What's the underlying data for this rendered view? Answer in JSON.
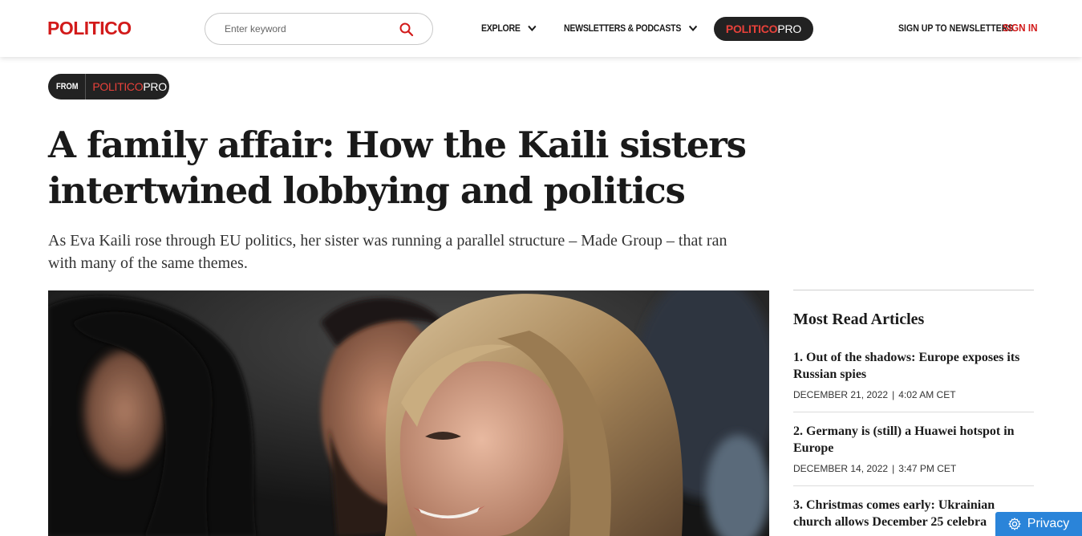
{
  "header": {
    "logo": "POLITICO",
    "search": {
      "placeholder": "Enter keyword"
    },
    "nav": [
      {
        "label": "EXPLORE"
      },
      {
        "label": "NEWSLETTERS & PODCASTS"
      }
    ],
    "pro": {
      "part1": "POLITICO",
      "part2": "PRO"
    },
    "signup": "SIGN UP TO NEWSLETTERS",
    "signin": "SIGN IN"
  },
  "badge": {
    "from": "FROM",
    "part1": "POLITICO",
    "part2": "PRO"
  },
  "article": {
    "headline": "A family affair: How the Kaili sisters intertwined lobbying and politics",
    "dek": "As Eva Kaili rose through EU politics, her sister was running a parallel structure – Made Group – that ran with many of the same themes."
  },
  "sidebar": {
    "title": "Most Read Articles",
    "items": [
      {
        "title": "1. Out of the shadows: Europe exposes its Russian spies",
        "date": "DECEMBER 21, 2022",
        "time": "4:02 AM CET"
      },
      {
        "title": "2. Germany is (still) a Huawei hotspot in Europe",
        "date": "DECEMBER 14, 2022",
        "time": "3:47 PM CET"
      },
      {
        "title": "3. Christmas comes early: Ukrainian church allows December 25 celebra",
        "date": "",
        "time": ""
      }
    ]
  },
  "privacy": {
    "label": "Privacy"
  },
  "colors": {
    "brand": "#d21a1a",
    "pro_red": "#e8413a",
    "dark_pill": "#222222",
    "privacy_blue": "#2a84d9"
  }
}
